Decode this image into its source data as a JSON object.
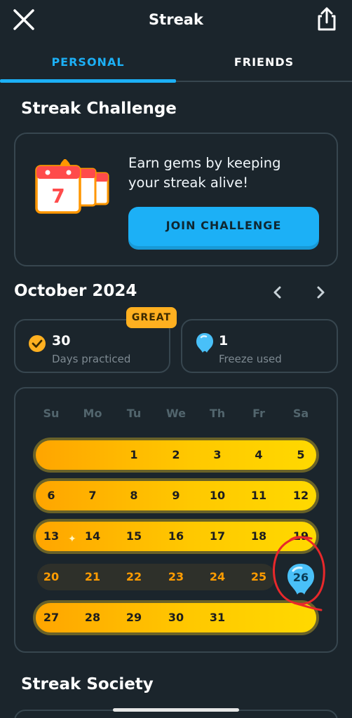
{
  "header": {
    "title": "Streak",
    "close_icon": "close-icon",
    "share_icon": "share-icon"
  },
  "tabs": [
    {
      "label": "PERSONAL",
      "active": true
    },
    {
      "label": "FRIENDS",
      "active": false
    }
  ],
  "challenge": {
    "section_title": "Streak Challenge",
    "calendar_day": "7",
    "line1": "Earn gems by keeping",
    "line2": "your streak alive!",
    "button_label": "JOIN CHALLENGE"
  },
  "month": {
    "title": "October 2024",
    "prev_icon": "chevron-left-icon",
    "next_icon": "chevron-right-icon"
  },
  "stats": {
    "days_value": "30",
    "days_label": "Days practiced",
    "badge": "GREAT",
    "freeze_value": "1",
    "freeze_label": "Freeze used"
  },
  "calendar": {
    "weekdays": [
      "Su",
      "Mo",
      "Tu",
      "We",
      "Th",
      "Fr",
      "Sa"
    ],
    "weeks": [
      [
        "",
        "",
        "1",
        "2",
        "3",
        "4",
        "5"
      ],
      [
        "6",
        "7",
        "8",
        "9",
        "10",
        "11",
        "12"
      ],
      [
        "13",
        "14",
        "15",
        "16",
        "17",
        "18",
        "19"
      ],
      [
        "20",
        "21",
        "22",
        "23",
        "24",
        "25",
        "26"
      ],
      [
        "27",
        "28",
        "29",
        "30",
        "31",
        "",
        ""
      ]
    ],
    "missed_days": [
      "20",
      "21",
      "22",
      "23",
      "24",
      "25"
    ],
    "frozen_day": "26",
    "sparkle": "✦",
    "colors": {
      "streak": "#ffc800",
      "missed_text": "#ff9c00",
      "freeze": "#1cb0f6"
    }
  },
  "society": {
    "section_title": "Streak Society"
  },
  "colors": {
    "accent": "#1cb0f6",
    "background": "#1b252c",
    "border": "#37464f",
    "badge": "#ffb020"
  }
}
